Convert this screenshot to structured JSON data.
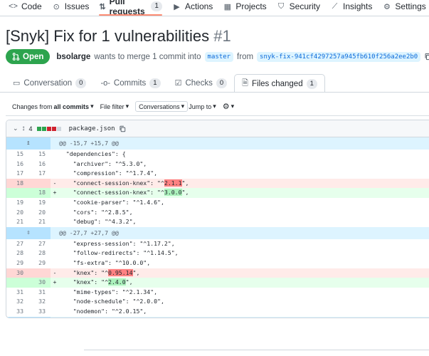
{
  "repo_nav": {
    "tabs": [
      {
        "label": "Code",
        "icon": "code-icon",
        "glyph": "<>"
      },
      {
        "label": "Issues",
        "icon": "issue-icon",
        "glyph": "⊙"
      },
      {
        "label": "Pull requests",
        "icon": "pull-request-icon",
        "glyph": "⇅",
        "count": "1",
        "active": true
      },
      {
        "label": "Actions",
        "icon": "play-icon",
        "glyph": "▶"
      },
      {
        "label": "Projects",
        "icon": "table-icon",
        "glyph": "▦"
      },
      {
        "label": "Security",
        "icon": "shield-icon",
        "glyph": "⛉"
      },
      {
        "label": "Insights",
        "icon": "graph-icon",
        "glyph": "⟋"
      },
      {
        "label": "Settings",
        "icon": "gear-icon",
        "glyph": "⚙"
      }
    ]
  },
  "pr": {
    "title": "[Snyk] Fix for 1 vulnerabilities",
    "number": "#1",
    "state": "Open",
    "author": "bsolarge",
    "merge_text": "wants to merge 1 commit into",
    "base_branch": "master",
    "from_text": "from",
    "head_branch": "snyk-fix-941cf4297257a945fb610f256a2ee2b0"
  },
  "pr_tabs": [
    {
      "label": "Conversation",
      "count": "0",
      "icon": "comment-icon",
      "glyph": "▭"
    },
    {
      "label": "Commits",
      "count": "1",
      "icon": "commit-icon",
      "glyph": "-o-"
    },
    {
      "label": "Checks",
      "count": "0",
      "icon": "checklist-icon",
      "glyph": "☑"
    },
    {
      "label": "Files changed",
      "count": "1",
      "icon": "file-diff-icon",
      "glyph": "🗎",
      "active": true
    }
  ],
  "toolbar": {
    "changes_from_prefix": "Changes from",
    "changes_from_value": "all commits",
    "file_filter": "File filter",
    "conversations": "Conversations",
    "jump_to": "Jump to"
  },
  "file": {
    "changes": "4",
    "name": "package.json",
    "stat_colors": [
      "#2da44e",
      "#2da44e",
      "#cf222e",
      "#cf222e",
      "#d0d7de"
    ]
  },
  "colors": {
    "accent": "#0969da",
    "open_green": "#2da44e",
    "nav_underline": "#fd8c73"
  },
  "diff": [
    {
      "type": "hunk",
      "text": "@@ -15,7 +15,7 @@",
      "expand": "↥"
    },
    {
      "type": "ctx",
      "old": "15",
      "new": "15",
      "code": "  \"dependencies\": {"
    },
    {
      "type": "ctx",
      "old": "16",
      "new": "16",
      "code": "    \"archiver\": \"^5.3.0\","
    },
    {
      "type": "ctx",
      "old": "17",
      "new": "17",
      "code": "    \"compression\": \"^1.7.4\","
    },
    {
      "type": "del",
      "old": "18",
      "new": "",
      "pre": "    \"connect-session-knex\": \"^",
      "hl": "2.1.1",
      "post": "\","
    },
    {
      "type": "add",
      "old": "",
      "new": "18",
      "pre": "    \"connect-session-knex\": \"^",
      "hl": "3.0.0",
      "post": "\","
    },
    {
      "type": "ctx",
      "old": "19",
      "new": "19",
      "code": "    \"cookie-parser\": \"^1.4.6\","
    },
    {
      "type": "ctx",
      "old": "20",
      "new": "20",
      "code": "    \"cors\": \"^2.8.5\","
    },
    {
      "type": "ctx",
      "old": "21",
      "new": "21",
      "code": "    \"debug\": \"^4.3.2\","
    },
    {
      "type": "hunk",
      "text": "@@ -27,7 +27,7 @@",
      "expand": "⇳"
    },
    {
      "type": "ctx",
      "old": "27",
      "new": "27",
      "code": "    \"express-session\": \"^1.17.2\","
    },
    {
      "type": "ctx",
      "old": "28",
      "new": "28",
      "code": "    \"follow-redirects\": \"^1.14.5\","
    },
    {
      "type": "ctx",
      "old": "29",
      "new": "29",
      "code": "    \"fs-extra\": \"^10.0.0\","
    },
    {
      "type": "del",
      "old": "30",
      "new": "",
      "pre": "    \"knex\": \"^",
      "hl": "0.95.14",
      "post": "\","
    },
    {
      "type": "add",
      "old": "",
      "new": "30",
      "pre": "    \"knex\": \"^",
      "hl": "2.4.0",
      "post": "\","
    },
    {
      "type": "ctx",
      "old": "31",
      "new": "31",
      "code": "    \"mime-types\": \"^2.1.34\","
    },
    {
      "type": "ctx",
      "old": "32",
      "new": "32",
      "code": "    \"node-schedule\": \"^2.0.0\","
    },
    {
      "type": "ctx",
      "old": "33",
      "new": "33",
      "code": "    \"nodemon\": \"^2.0.15\","
    },
    {
      "type": "bottom",
      "expand": "↧"
    }
  ]
}
